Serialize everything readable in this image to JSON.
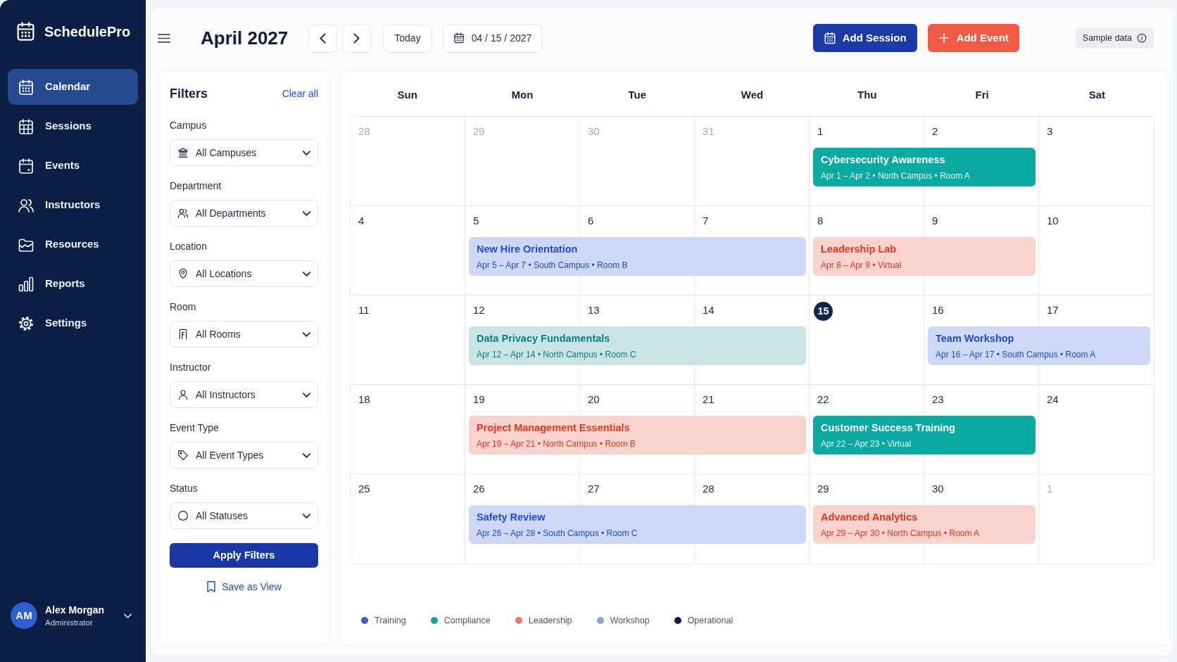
{
  "sidebar": {
    "brand": "SchedulePro",
    "items": [
      {
        "label": "Calendar",
        "selected": true
      },
      {
        "label": "Sessions",
        "selected": false
      },
      {
        "label": "Events",
        "selected": false
      },
      {
        "label": "Instructors",
        "selected": false
      },
      {
        "label": "Resources",
        "selected": false
      },
      {
        "label": "Reports",
        "selected": false
      },
      {
        "label": "Settings",
        "selected": false
      }
    ],
    "user": {
      "initials": "AM",
      "name": "Alex Morgan",
      "role": "Administrator"
    }
  },
  "header": {
    "title": "April 2027",
    "today_button": "Today",
    "date_field": "04 / 15 / 2027",
    "add_session": "Add Session",
    "add_event": "Add Event",
    "badge": "Sample data"
  },
  "filters": {
    "title": "Filters",
    "clear": "Clear all",
    "fields": [
      {
        "label": "Campus",
        "value": "All Campuses"
      },
      {
        "label": "Department",
        "value": "All Departments"
      },
      {
        "label": "Location",
        "value": "All Locations"
      },
      {
        "label": "Room",
        "value": "All Rooms"
      },
      {
        "label": "Instructor",
        "value": "All Instructors"
      },
      {
        "label": "Event Type",
        "value": "All Event Types"
      },
      {
        "label": "Status",
        "value": "All Statuses"
      }
    ],
    "apply": "Apply Filters",
    "save_view": "Save as View"
  },
  "calendar": {
    "weekdays": [
      "Sun",
      "Mon",
      "Tue",
      "Wed",
      "Thu",
      "Fri",
      "Sat"
    ],
    "weeks": [
      {
        "segments": [
          {
            "days": [
              {
                "label": "28",
                "outside": true,
                "today": false
              },
              {
                "label": "29",
                "outside": true,
                "today": false
              },
              {
                "label": "30",
                "outside": true,
                "today": false
              },
              {
                "label": "31",
                "outside": true,
                "today": false
              }
            ]
          },
          {
            "days": [
              {
                "label": "1",
                "outside": false,
                "today": false
              },
              {
                "label": "2",
                "outside": false,
                "today": false
              }
            ],
            "event": {
              "title": "Cybersecurity Awareness",
              "details": "Apr 1 – Apr 2 • North Campus • Room A",
              "kind": "solid",
              "color": "#0aa9a2"
            }
          },
          {
            "days": [
              {
                "label": "3",
                "outside": false,
                "today": false
              }
            ]
          }
        ]
      },
      {
        "segments": [
          {
            "days": [
              {
                "label": "4",
                "outside": false,
                "today": false
              }
            ]
          },
          {
            "days": [
              {
                "label": "5",
                "outside": false,
                "today": false
              },
              {
                "label": "6",
                "outside": false,
                "today": false
              },
              {
                "label": "7",
                "outside": false,
                "today": false
              }
            ],
            "event": {
              "title": "New Hire Orientation",
              "details": "Apr 5 – Apr 7 • South Campus • Room B",
              "kind": "soft",
              "color": "#1d4ed8"
            }
          },
          {
            "days": [
              {
                "label": "8",
                "outside": false,
                "today": false
              },
              {
                "label": "9",
                "outside": false,
                "today": false
              }
            ],
            "event": {
              "title": "Leadership Lab",
              "details": "Apr 8 – Apr 9 • Virtual",
              "kind": "soft",
              "color": "#e5381f"
            }
          },
          {
            "days": [
              {
                "label": "10",
                "outside": false,
                "today": false
              }
            ]
          }
        ]
      },
      {
        "segments": [
          {
            "days": [
              {
                "label": "11",
                "outside": false,
                "today": false
              }
            ]
          },
          {
            "days": [
              {
                "label": "12",
                "outside": false,
                "today": false
              },
              {
                "label": "13",
                "outside": false,
                "today": false
              },
              {
                "label": "14",
                "outside": false,
                "today": false
              }
            ],
            "event": {
              "title": "Data Privacy Fundamentals",
              "details": "Apr 12 – Apr 14 • North Campus • Room C",
              "kind": "soft",
              "color": "#0f7f88"
            }
          },
          {
            "days": [
              {
                "label": "15",
                "outside": false,
                "today": true
              }
            ]
          },
          {
            "days": [
              {
                "label": "16",
                "outside": false,
                "today": false
              },
              {
                "label": "17",
                "outside": false,
                "today": false
              }
            ],
            "event": {
              "title": "Team Workshop",
              "details": "Apr 16 – Apr 17 • South Campus • Room A",
              "kind": "soft",
              "color": "#1d4ed8"
            }
          }
        ]
      },
      {
        "segments": [
          {
            "days": [
              {
                "label": "18",
                "outside": false,
                "today": false
              }
            ]
          },
          {
            "days": [
              {
                "label": "19",
                "outside": false,
                "today": false
              },
              {
                "label": "20",
                "outside": false,
                "today": false
              },
              {
                "label": "21",
                "outside": false,
                "today": false
              }
            ],
            "event": {
              "title": "Project Management Essentials",
              "details": "Apr 19 – Apr 21 • North Campus • Room B",
              "kind": "soft",
              "color": "#e5381f"
            }
          },
          {
            "days": [
              {
                "label": "22",
                "outside": false,
                "today": false
              },
              {
                "label": "23",
                "outside": false,
                "today": false
              }
            ],
            "event": {
              "title": "Customer Success Training",
              "details": "Apr 22 – Apr 23 • Virtual",
              "kind": "solid",
              "color": "#0aa9a2"
            }
          },
          {
            "days": [
              {
                "label": "24",
                "outside": false,
                "today": false
              }
            ]
          }
        ]
      },
      {
        "segments": [
          {
            "days": [
              {
                "label": "25",
                "outside": false,
                "today": false
              }
            ]
          },
          {
            "days": [
              {
                "label": "26",
                "outside": false,
                "today": false
              },
              {
                "label": "27",
                "outside": false,
                "today": false
              },
              {
                "label": "28",
                "outside": false,
                "today": false
              }
            ],
            "event": {
              "title": "Safety Review",
              "details": "Apr 26 – Apr 28 • South Campus • Room C",
              "kind": "soft",
              "color": "#1d4ed8"
            }
          },
          {
            "days": [
              {
                "label": "29",
                "outside": false,
                "today": false
              },
              {
                "label": "30",
                "outside": false,
                "today": false
              }
            ],
            "event": {
              "title": "Advanced Analytics",
              "details": "Apr 29 – Apr 30 • North Campus • Room A",
              "kind": "soft",
              "color": "#e5381f"
            }
          },
          {
            "days": [
              {
                "label": "1",
                "outside": true,
                "today": false
              }
            ]
          }
        ]
      }
    ],
    "legend": [
      {
        "label": "Training",
        "color": "#3461d3"
      },
      {
        "label": "Compliance",
        "color": "#14a39a"
      },
      {
        "label": "Leadership",
        "color": "#f07462"
      },
      {
        "label": "Workshop",
        "color": "#8aa2e3"
      },
      {
        "label": "Operational",
        "color": "#0f1f3d"
      }
    ]
  }
}
